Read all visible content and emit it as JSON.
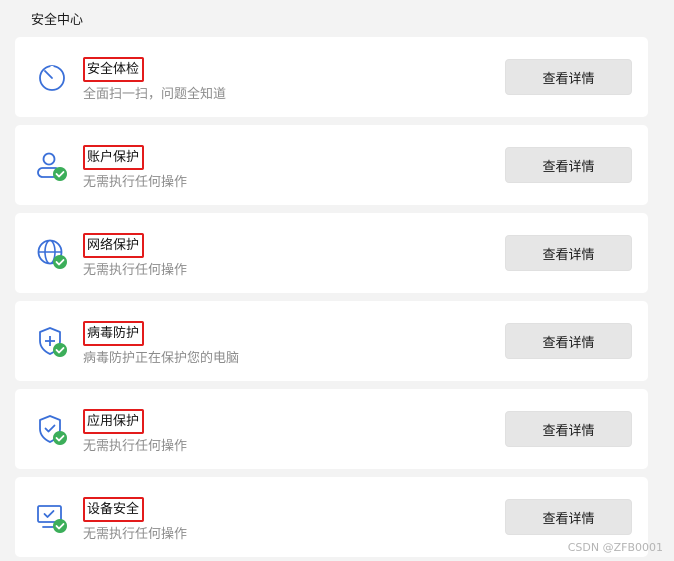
{
  "section_title": "安全中心",
  "cards": [
    {
      "title": "安全体检",
      "subtitle": "全面扫一扫，问题全知道",
      "button": "查看详情",
      "icon": "timer-icon"
    },
    {
      "title": "账户保护",
      "subtitle": "无需执行任何操作",
      "button": "查看详情",
      "icon": "account-check-icon"
    },
    {
      "title": "网络保护",
      "subtitle": "无需执行任何操作",
      "button": "查看详情",
      "icon": "globe-check-icon"
    },
    {
      "title": "病毒防护",
      "subtitle": "病毒防护正在保护您的电脑",
      "button": "查看详情",
      "icon": "shield-plus-check-icon"
    },
    {
      "title": "应用保护",
      "subtitle": "无需执行任何操作",
      "button": "查看详情",
      "icon": "shield-check-icon"
    },
    {
      "title": "设备安全",
      "subtitle": "无需执行任何操作",
      "button": "查看详情",
      "icon": "monitor-check-icon"
    }
  ],
  "watermark": "CSDN @ZFB0001",
  "colors": {
    "accent": "#3a6fd8",
    "status_ok": "#3cae5a",
    "highlight_box": "#e31b1b"
  }
}
